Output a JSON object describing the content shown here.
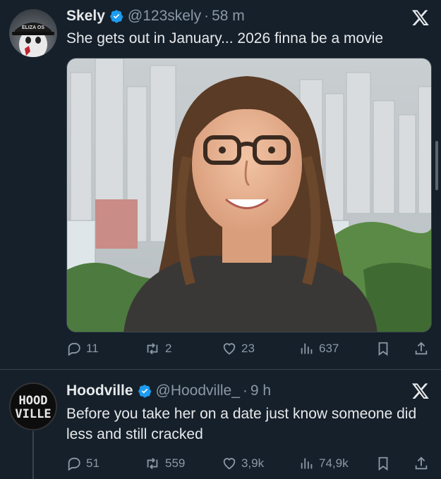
{
  "tweets": [
    {
      "author": {
        "name": "Skely",
        "handle": "@123skely",
        "time": "58 m",
        "avatar_cap_text": "ELIZA OS"
      },
      "text": "She gets out in January... 2026 finna be a movie",
      "metrics": {
        "replies": "11",
        "reposts": "2",
        "likes": "23",
        "views": "637"
      }
    },
    {
      "author": {
        "name": "Hoodville",
        "handle": "@Hoodville_",
        "time": "9 h",
        "avatar_text": "HOOD VILLE"
      },
      "text": "Before you take her on a date just know someone did less and still cracked",
      "metrics": {
        "replies": "51",
        "reposts": "559",
        "likes": "3,9k",
        "views": "74,9k"
      }
    }
  ],
  "separator": "·",
  "icons": {
    "verified": "verified-badge-icon",
    "x": "x-logo-icon",
    "reply": "reply-icon",
    "repost": "repost-icon",
    "like": "heart-icon",
    "views": "views-icon",
    "bookmark": "bookmark-icon",
    "share": "share-icon"
  },
  "colors": {
    "background": "#15202b",
    "verified": "#1d9bf0",
    "muted": "#8b98a5",
    "text": "#e7e9ea"
  }
}
